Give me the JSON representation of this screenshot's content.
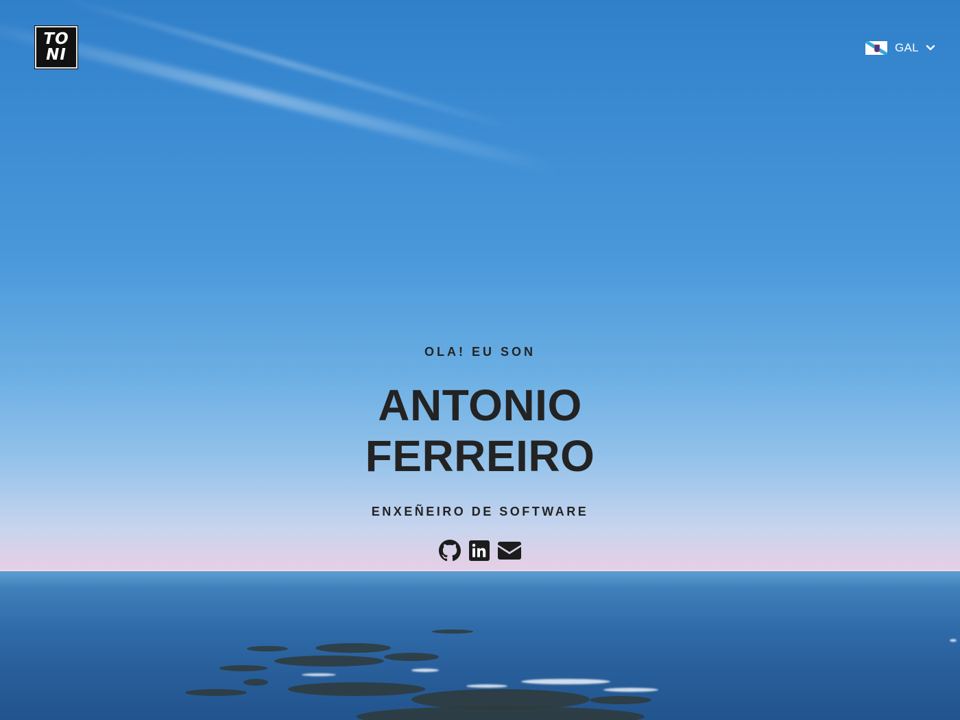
{
  "header": {
    "logo": {
      "line1": "TO",
      "line2": "NI"
    },
    "language": {
      "flag_icon": "galicia-flag-icon",
      "selected": "GAL",
      "chevron_icon": "chevron-down-icon"
    }
  },
  "hero": {
    "greeting": "OLA! EU SON",
    "name_line1": "ANTONIO",
    "name_line2": "FERREIRO",
    "role": "ENXEÑEIRO DE SOFTWARE",
    "socials": [
      {
        "icon": "github-icon"
      },
      {
        "icon": "linkedin-icon"
      },
      {
        "icon": "email-icon"
      }
    ]
  },
  "colors": {
    "text": "#232323",
    "header_text": "#ffffff",
    "sky_top": "#2f7fc9",
    "sea": "#2f6aa8"
  }
}
